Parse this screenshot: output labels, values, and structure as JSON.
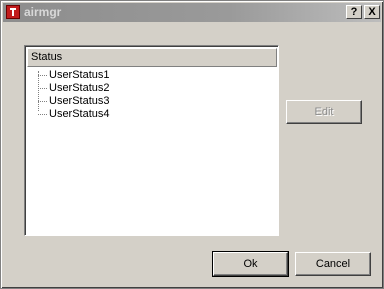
{
  "window": {
    "title": "airmgr",
    "help_label": "?",
    "close_label": "X"
  },
  "tree": {
    "header": "Status",
    "items": [
      "UserStatus1",
      "UserStatus2",
      "UserStatus3",
      "UserStatus4"
    ]
  },
  "buttons": {
    "edit_label": "Edit",
    "ok_label": "Ok",
    "cancel_label": "Cancel"
  }
}
